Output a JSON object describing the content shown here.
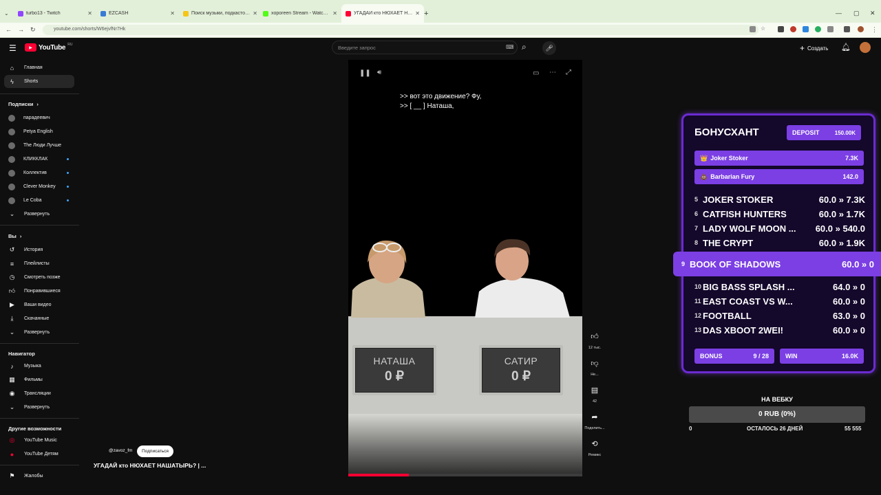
{
  "browser": {
    "tabs": [
      {
        "label": "turbo13 - Twitch",
        "favicon_color": "#9146ff"
      },
      {
        "label": "EZCASH",
        "favicon_color": "#3a7bd5"
      },
      {
        "label": "Поиск музыки, подкастов и аудиокн...",
        "favicon_color": "#f5c518"
      },
      {
        "label": "xoporeen Stream - Watch Live on Kick",
        "favicon_color": "#53fc18"
      },
      {
        "label": "УГАДАЙ кто НЮХАЕТ НАШ...",
        "favicon_color": "#ff0033"
      }
    ],
    "new_tab": "+",
    "url": "youtube.com/shorts/W6ejvfNr7Hk"
  },
  "youtube": {
    "logo_text": "YouTube",
    "logo_sup": "RU",
    "search_placeholder": "Введите запрос",
    "create_label": "Создать",
    "sidebar": {
      "main": [
        {
          "label": "Главная",
          "icon": "home-icon"
        },
        {
          "label": "Shorts",
          "icon": "shorts-icon"
        }
      ],
      "subs_heading": "Подписки",
      "subs": [
        {
          "label": "парадеевич",
          "dot": false
        },
        {
          "label": "Petya English",
          "dot": false
        },
        {
          "label": "The Люди Лучше",
          "dot": false
        },
        {
          "label": "КЛИККЛАК",
          "dot": true
        },
        {
          "label": "Коллектив",
          "dot": true
        },
        {
          "label": "Clever Monkey",
          "dot": true
        },
        {
          "label": "Le Coba",
          "dot": true
        }
      ],
      "expand1": "Развернуть",
      "you_heading": "Вы",
      "you": [
        {
          "label": "История",
          "icon": "history-icon"
        },
        {
          "label": "Плейлисты",
          "icon": "playlist-icon"
        },
        {
          "label": "Смотреть позже",
          "icon": "watch-later-icon"
        },
        {
          "label": "Понравившиеся",
          "icon": "liked-icon"
        },
        {
          "label": "Ваши видео",
          "icon": "your-videos-icon"
        },
        {
          "label": "Скачанные",
          "icon": "download-icon"
        },
        {
          "label": "Развернуть",
          "icon": "chevron-down-icon"
        }
      ],
      "nav_heading": "Навигатор",
      "nav": [
        {
          "label": "Музыка",
          "icon": "music-icon"
        },
        {
          "label": "Фильмы",
          "icon": "film-icon"
        },
        {
          "label": "Трансляции",
          "icon": "live-icon"
        },
        {
          "label": "Развернуть",
          "icon": "chevron-down-icon"
        }
      ],
      "other_heading": "Другие возможности",
      "other": [
        {
          "label": "YouTube Music",
          "icon": "yt-music-icon"
        },
        {
          "label": "YouTube Детям",
          "icon": "yt-kids-icon"
        }
      ],
      "report": "Жалобы"
    },
    "short": {
      "captions": [
        ">> вот это движение? Фу,",
        ">> [ __ ] Наташа,"
      ],
      "podiums": [
        {
          "name": "НАТАША",
          "money": "0 ₽"
        },
        {
          "name": "САТИР",
          "money": "0 ₽"
        }
      ],
      "channel": "@zavoz_fm",
      "subscribe": "Подписаться",
      "title": "УГАДАЙ кто НЮХАЕТ НАШАТЫРЬ? | ...",
      "progress": 0.26
    },
    "actions": [
      {
        "icon": "like-icon",
        "label": "12 тыс."
      },
      {
        "icon": "dislike-icon",
        "label": "Не..."
      },
      {
        "icon": "comments-icon",
        "label": "42"
      },
      {
        "icon": "share-icon",
        "label": "Поделить..."
      },
      {
        "icon": "remix-icon",
        "label": "Ремикс"
      }
    ]
  },
  "bonus_overlay": {
    "title": "БОНУСХАНТ",
    "deposit_label": "DEPOSIT",
    "deposit_value": "150.00K",
    "highlights": [
      {
        "icon": "👑",
        "name": "Joker Stoker",
        "value": "7.3K"
      },
      {
        "icon": "💩",
        "name": "Barbarian Fury",
        "value": "142.0"
      }
    ],
    "rows": [
      {
        "n": "5",
        "name": "JOKER STOKER",
        "val": "60.0 » 7.3K"
      },
      {
        "n": "6",
        "name": "CATFISH HUNTERS",
        "val": "60.0 » 1.7K"
      },
      {
        "n": "7",
        "name": "LADY WOLF MOON ...",
        "val": "60.0 » 540.0"
      },
      {
        "n": "8",
        "name": "THE CRYPT",
        "val": "60.0 » 1.9K"
      }
    ],
    "active": {
      "n": "9",
      "name": "BOOK OF SHADOWS",
      "val": "60.0 » 0"
    },
    "rows2": [
      {
        "n": "10",
        "name": "BIG BASS SPLASH ...",
        "val": "64.0 » 0"
      },
      {
        "n": "11",
        "name": "EAST COAST VS W...",
        "val": "60.0 » 0"
      },
      {
        "n": "12",
        "name": "FOOTBALL",
        "val": "63.0 » 0"
      },
      {
        "n": "13",
        "name": "DAS XBOOT 2WEI!",
        "val": "60.0 » 0"
      }
    ],
    "bonus_label": "BONUS",
    "bonus_value": "9 / 28",
    "win_label": "WIN",
    "win_value": "16.0K"
  },
  "webcam": {
    "title": "НА ВЕБКУ",
    "progress_text": "0 RUB (0%)",
    "min": "0",
    "remaining": "ОСТАЛОСЬ 26 ДНЕЙ",
    "max": "55 555"
  },
  "colors": {
    "accent": "#7b3fe4",
    "yt_red": "#ff0033"
  }
}
